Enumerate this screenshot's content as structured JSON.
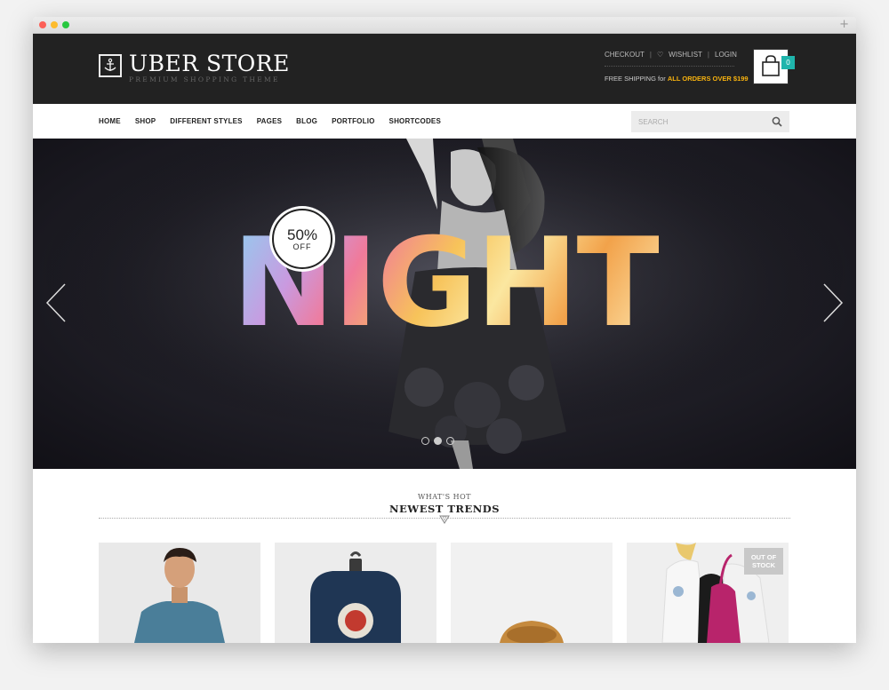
{
  "brand": {
    "title": "UBER STORE",
    "tagline": "PREMIUM SHOPPING THEME"
  },
  "top_links": {
    "checkout": "CHECKOUT",
    "wishlist": "WISHLIST",
    "login": "LOGIN"
  },
  "shipping": {
    "prefix": "FREE SHIPPING for ",
    "highlight": "ALL ORDERS OVER $199"
  },
  "cart": {
    "count": "0"
  },
  "nav": {
    "items": [
      "HOME",
      "SHOP",
      "DIFFERENT STYLES",
      "PAGES",
      "BLOG",
      "PORTFOLIO",
      "SHORTCODES"
    ]
  },
  "search": {
    "placeholder": "SEARCH"
  },
  "hero": {
    "badge_percent": "50%",
    "badge_off": "OFF",
    "headline": "NIGHT",
    "slides": 3,
    "active_slide": 2
  },
  "section": {
    "eyebrow": "WHAT'S HOT",
    "title": "NEWEST TRENDS"
  },
  "products": [
    {
      "image": "man-in-blue-tshirt"
    },
    {
      "image": "navy-backpack"
    },
    {
      "image": "straw-hat"
    },
    {
      "image": "woman-with-pink-bag",
      "badge": "OUT OF STOCK"
    }
  ],
  "colors": {
    "header_bg": "#222222",
    "accent_yellow": "#f7b20f",
    "cart_teal": "#1fb5ac"
  }
}
